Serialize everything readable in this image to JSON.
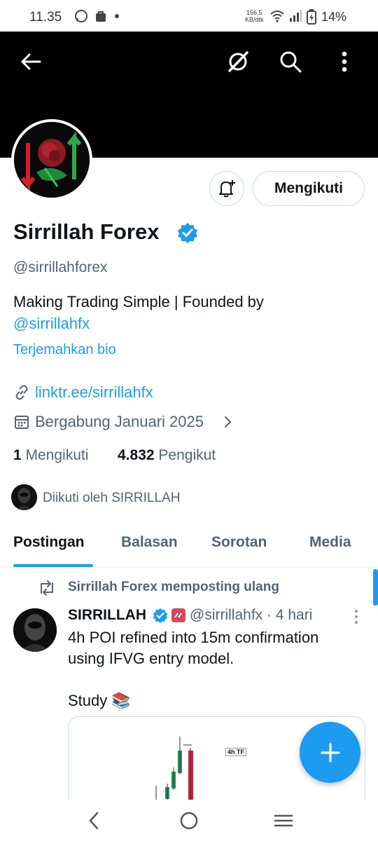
{
  "status_bar": {
    "time": "11.35",
    "net_speed_value": "156,5",
    "net_speed_unit": "KB/dtk",
    "battery": "14%"
  },
  "header": {
    "back_icon": "arrow-left-icon",
    "grok_icon": "grok-icon",
    "search_icon": "search-icon",
    "more_icon": "more-vertical-icon"
  },
  "profile": {
    "display_name": "Sirrillah Forex",
    "handle": "@sirrillahforex",
    "bio_text": "Making Trading Simple | Founded by",
    "bio_mention": "@sirrillahfx",
    "translate_label": "Terjemahkan bio",
    "website": "linktr.ee/sirrillahfx",
    "joined": "Bergabung Januari 2025",
    "following_count": "1",
    "following_label": "Mengikuti",
    "followers_count": "4.832",
    "followers_label": "Pengikut",
    "followed_by": "Diikuti oleh SIRRILLAH",
    "follow_button": "Mengikuti",
    "accent_color": "#1d9bf0"
  },
  "tabs": [
    {
      "label": "Postingan",
      "active": true
    },
    {
      "label": "Balasan",
      "active": false
    },
    {
      "label": "Sorotan",
      "active": false
    },
    {
      "label": "Media",
      "active": false
    }
  ],
  "post": {
    "repost_label": "Sirrillah Forex memposting ulang",
    "author": "SIRRILLAH",
    "handle_time": "@sirrillahfx · 4 hari",
    "text": "4h POI refined into 15m confirmation\nusing IFVG entry model.\n\nStudy 📚",
    "media_label": "4h TF"
  }
}
